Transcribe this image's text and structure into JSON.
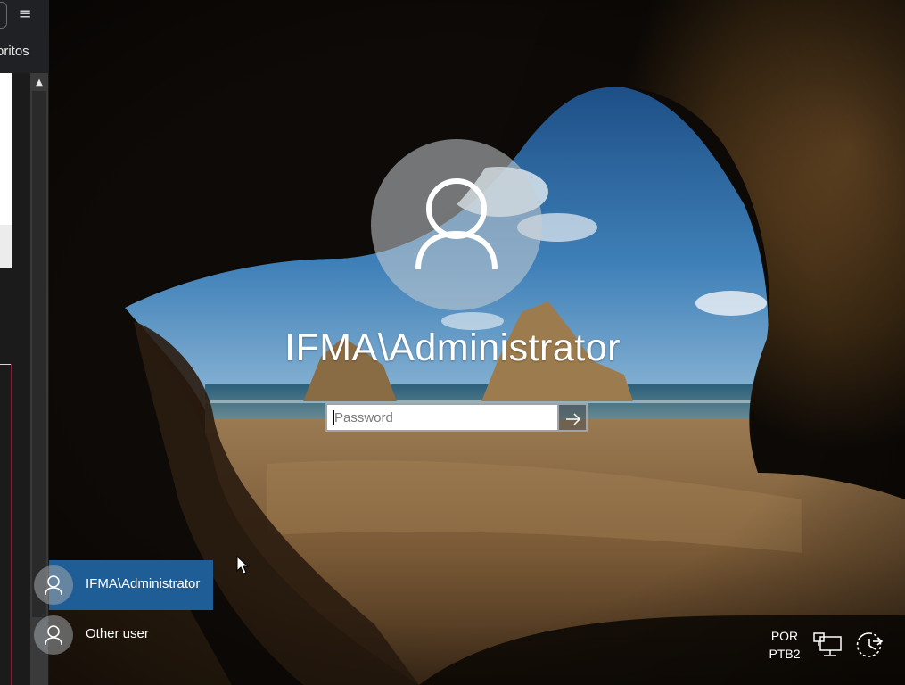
{
  "browser": {
    "favorites_fragment": "oritos",
    "menu_icon": "hamburger-menu-icon"
  },
  "login": {
    "username": "IFMA\\Administrator",
    "password_placeholder": "Password",
    "password_value": "",
    "submit_icon": "arrow-right-icon"
  },
  "users": [
    {
      "label": "IFMA\\Administrator",
      "selected": true
    },
    {
      "label": "Other user",
      "selected": false
    }
  ],
  "tray": {
    "language_line1": "POR",
    "language_line2": "PTB2",
    "network_icon": "network-icon",
    "power_icon": "ease-of-access-icon"
  },
  "colors": {
    "selected_user_bg": "#1f5d96",
    "sky": "#2f6ea8",
    "sand": "#8a6a44"
  }
}
